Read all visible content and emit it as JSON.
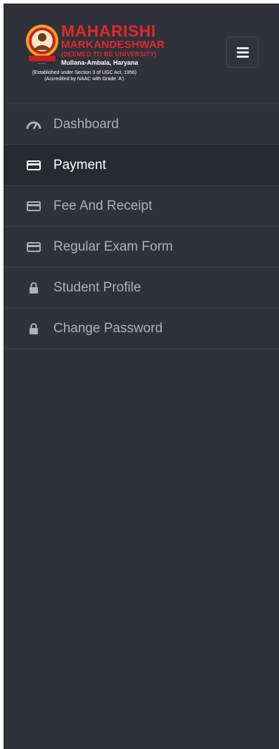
{
  "logo": {
    "line1": "MAHARISHI",
    "line2": "MARKANDESHWAR",
    "line3": "(DEEMED TO BE UNIVERSITY)",
    "line4": "Mullana-Ambala, Haryana",
    "line5": "(Established under Section 3 of UGC Act, 1956)",
    "line6": "(Accredited by NAAC with Grade 'A')"
  },
  "menu_toggle": {
    "icon": "hamburger-icon"
  },
  "nav": {
    "items": [
      {
        "label": "Dashboard",
        "icon": "dashboard-gauge-icon",
        "active": false
      },
      {
        "label": "Payment",
        "icon": "credit-card-icon",
        "active": true
      },
      {
        "label": "Fee And Receipt",
        "icon": "credit-card-icon",
        "active": false
      },
      {
        "label": "Regular Exam Form",
        "icon": "credit-card-icon",
        "active": false
      },
      {
        "label": "Student Profile",
        "icon": "lock-icon",
        "active": false
      },
      {
        "label": "Change Password",
        "icon": "lock-icon",
        "active": false
      }
    ]
  },
  "colors": {
    "sidebar_bg": "#2f323a",
    "active_bg": "#272a31",
    "text": "#aeb2b7",
    "active_text": "#ffffff",
    "brand_red": "#e3282c"
  }
}
